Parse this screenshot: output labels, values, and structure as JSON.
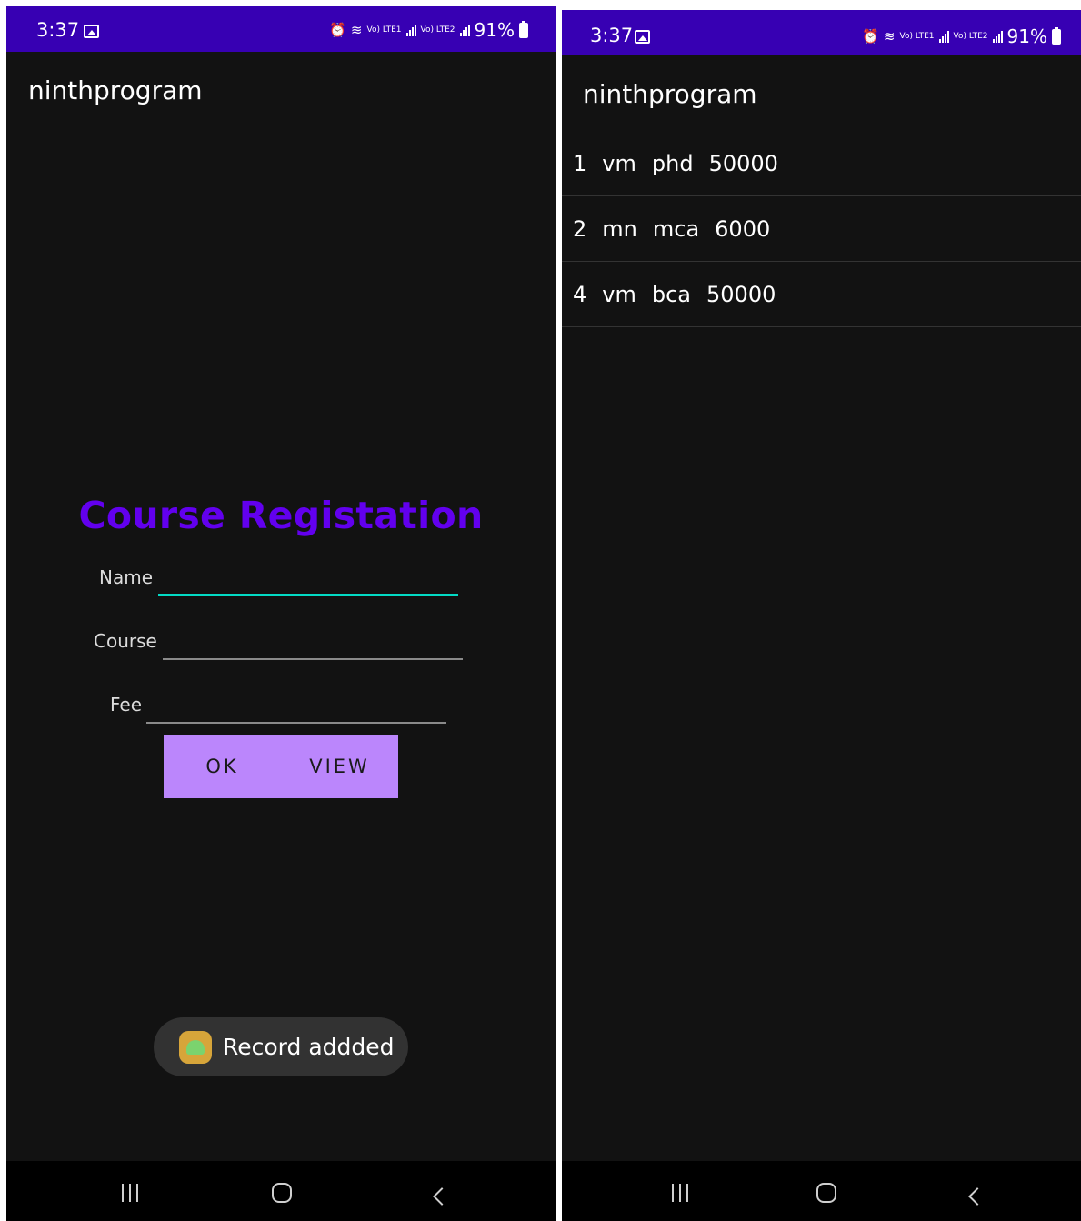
{
  "status_bar": {
    "time": "3:37",
    "battery": "91%",
    "lte1": "Vo) LTE1",
    "lte2": "Vo) LTE2"
  },
  "left_screen": {
    "app_title": "ninthprogram",
    "form": {
      "title": "Course Registation",
      "name_label": "Name",
      "name_value": "",
      "course_label": "Course",
      "course_value": "",
      "fee_label": "Fee",
      "fee_value": ""
    },
    "buttons": {
      "ok": "OK",
      "view": "VIEW"
    },
    "toast": "Record addded"
  },
  "right_screen": {
    "app_title": "ninthprogram",
    "records": [
      {
        "id": "1",
        "name": "vm",
        "course": "phd",
        "fee": "50000"
      },
      {
        "id": "2",
        "name": "mn",
        "course": "mca",
        "fee": "6000"
      },
      {
        "id": "4",
        "name": "vm",
        "course": "bca",
        "fee": "50000"
      }
    ]
  },
  "colors": {
    "status_bar": "#3700b3",
    "title_accent": "#6200ee",
    "button": "#bb86fc",
    "focus_underline": "#03dac5",
    "background": "#121212"
  },
  "icons": [
    "gallery-icon",
    "alarm-icon",
    "wifi-icon",
    "signal-icon",
    "battery-icon",
    "recent-apps-icon",
    "home-icon",
    "back-icon",
    "app-icon"
  ]
}
